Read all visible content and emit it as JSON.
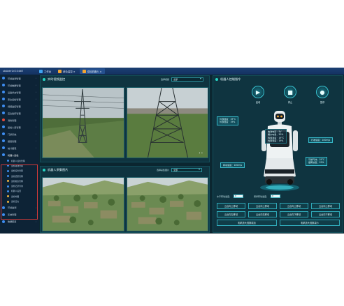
{
  "titlebar": {
    "app_name": "ubiAidrr2d 1O4diE",
    "tabs": [
      {
        "label": "工作台",
        "icon": "home-icon"
      },
      {
        "label": "综合监控 ×",
        "icon": "monitor-icon"
      },
      {
        "label": "巡检机器人 ×",
        "icon": "robot-icon"
      }
    ]
  },
  "sidebar": {
    "items": [
      {
        "label": "环境监测管理",
        "color": "#3e8df0"
      },
      {
        "label": "环境数据管理",
        "color": "#3e8df0"
      },
      {
        "label": "设备状态管理",
        "color": "#3e8df0"
      },
      {
        "label": "安全巡检管理",
        "color": "#3e8df0"
      },
      {
        "label": "视频监控管理",
        "color": "#3e8df0"
      },
      {
        "label": "应急指挥管理",
        "color": "#3e8df0"
      },
      {
        "label": "消防管理",
        "color": "#e04a3a"
      },
      {
        "label": "巡检人员管理",
        "color": "#3e8df0"
      },
      {
        "label": "门禁系统",
        "color": "#3e8df0"
      },
      {
        "label": "报警管理",
        "color": "#3e8df0"
      },
      {
        "label": "统计报表",
        "color": "#3e8df0"
      }
    ],
    "group": {
      "label": "机器人巡检",
      "subitems": [
        {
          "label": "机器人巡检管理",
          "color": "#3e8df0"
        },
        {
          "label": "巡检路线管理",
          "color": "#3e8df0"
        },
        {
          "label": "巡检任务管理",
          "color": "#3e8df0"
        },
        {
          "label": "巡检结果管理",
          "color": "#3e8df0"
        },
        {
          "label": "巡检报表管理",
          "color": "#f0b43e"
        },
        {
          "label": "巡检记录查询",
          "color": "#3e8df0"
        },
        {
          "label": "机器人设置",
          "color": "#3e8df0"
        },
        {
          "label": "巡检地图",
          "color": "#f0b43e"
        },
        {
          "label": "巡检日志",
          "color": "#f0b43e"
        }
      ]
    },
    "tail_items": [
      {
        "label": "环境监测",
        "color": "#3e8df0"
      },
      {
        "label": "系统管理",
        "color": "#3e8df0"
      },
      {
        "label": "数据配置",
        "color": "#3e8df0"
      }
    ]
  },
  "video_panel": {
    "title": "实时视频监控",
    "select_label": "选择视频",
    "select_value": "全部",
    "pager": "• •"
  },
  "photo_panel": {
    "title": "机器人采集图片",
    "select_label": "选择采集图片",
    "select_value": "全部"
  },
  "robot_panel": {
    "title": "机器人控制指令",
    "controls": [
      {
        "label": "启动",
        "icon": "play-icon"
      },
      {
        "label": "停止",
        "icon": "stop-icon"
      },
      {
        "label": "急停",
        "icon": "emergency-stop-icon"
      }
    ],
    "left_temps": [
      "外部温度：19°C",
      "外部湿度：19%"
    ],
    "status": [
      "电池电压：5V",
      "剩余电量：50%",
      "内部温度：19°C",
      "内部湿度：19%"
    ],
    "right_speed": "行驶速度：100m/s",
    "right_temps": [
      "可燃气体：19°C",
      "烟雾浓度：19%"
    ],
    "left_speed": "转动速度：100m/s",
    "speed_field_label": "水平转动速度：",
    "speed_field_value": "0",
    "angle_field_label": "俯仰转动速度：",
    "angle_field_value": "0",
    "move_buttons": [
      "云台向上移动",
      "云台向上移动",
      "云台向上移动",
      "云台向上移动",
      "云台向左移动",
      "云台向右移动",
      "云台向下移动",
      "云台向下移动",
      "相机放大倍数增加",
      "相机放大倍数减小"
    ]
  }
}
